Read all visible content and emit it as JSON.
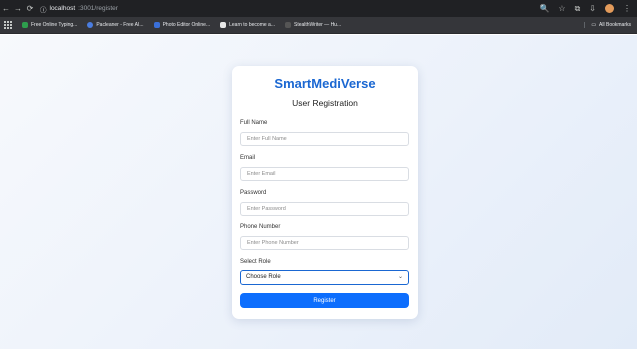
{
  "browser": {
    "url_host": "localhost",
    "url_path": ":3001/register",
    "bookmarks": [
      {
        "label": "Free Online Typing...",
        "color": "#2e9e4d"
      },
      {
        "label": "Pacleaner - Free AI...",
        "color": "#4a7de0"
      },
      {
        "label": "Photo Editor Online...",
        "color": "#3a6fd8"
      },
      {
        "label": "Learn to become a...",
        "color": "#e8e8e8"
      },
      {
        "label": "StealthWriter — Hu...",
        "color": "#555555"
      }
    ],
    "all_bookmarks_label": "All Bookmarks"
  },
  "form": {
    "brand": "SmartMediVerse",
    "title": "User Registration",
    "fields": [
      {
        "label": "Full Name",
        "placeholder": "Enter Full Name"
      },
      {
        "label": "Email",
        "placeholder": "Enter Email"
      },
      {
        "label": "Password",
        "placeholder": "Enter Password"
      },
      {
        "label": "Phone Number",
        "placeholder": "Enter Phone Number"
      }
    ],
    "role_label": "Select Role",
    "role_selected": "Choose Role",
    "submit_label": "Register"
  },
  "colors": {
    "brand": "#1a67d2",
    "button": "#0d6efd"
  }
}
